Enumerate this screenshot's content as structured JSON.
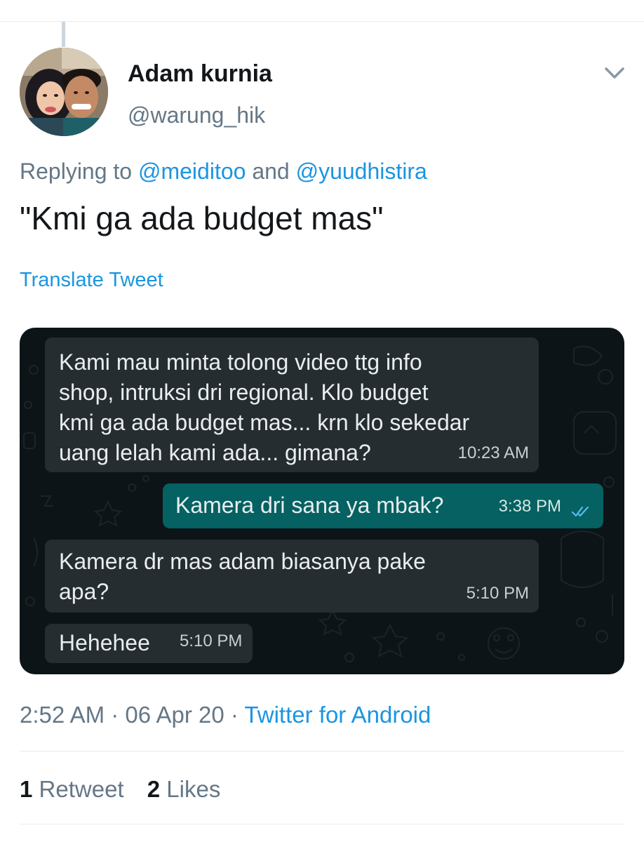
{
  "author": {
    "name": "Adam kurnia",
    "handle": "@warung_hik"
  },
  "reply": {
    "prefix": "Replying to ",
    "mention1": "@meiditoo",
    "conjunction": " and ",
    "mention2": "@yuudhistira"
  },
  "tweet": {
    "text": "\"Kmi ga ada budget mas\"",
    "translate_label": "Translate Tweet"
  },
  "chat": {
    "messages": [
      {
        "direction": "incoming",
        "text": "Kami mau minta tolong video ttg info\nshop, intruksi dri regional. Klo budget\nkmi ga ada budget mas... krn klo sekedar\nuang lelah kami ada... gimana?",
        "time": "10:23 AM"
      },
      {
        "direction": "outgoing",
        "text": "Kamera dri sana ya mbak?",
        "time": "3:38 PM",
        "status_icon": "double-check-icon"
      },
      {
        "direction": "incoming",
        "text": "Kamera dr mas adam biasanya pake\napa?",
        "time": "5:10 PM"
      },
      {
        "direction": "incoming",
        "text": "Hehehee",
        "time": "5:10 PM"
      }
    ]
  },
  "meta": {
    "time": "2:52 AM",
    "separator": " · ",
    "date": "06 Apr 20",
    "source": "Twitter for Android"
  },
  "stats": {
    "retweets_count": "1",
    "retweets_label": " Retweet",
    "likes_count": "2",
    "likes_label": " Likes"
  },
  "colors": {
    "link": "#1b95e0",
    "secondary_text": "#657786",
    "chat_background": "#0d1418",
    "incoming_bubble": "#262d31",
    "outgoing_bubble": "#056162",
    "read_ticks": "#53bdeb"
  }
}
